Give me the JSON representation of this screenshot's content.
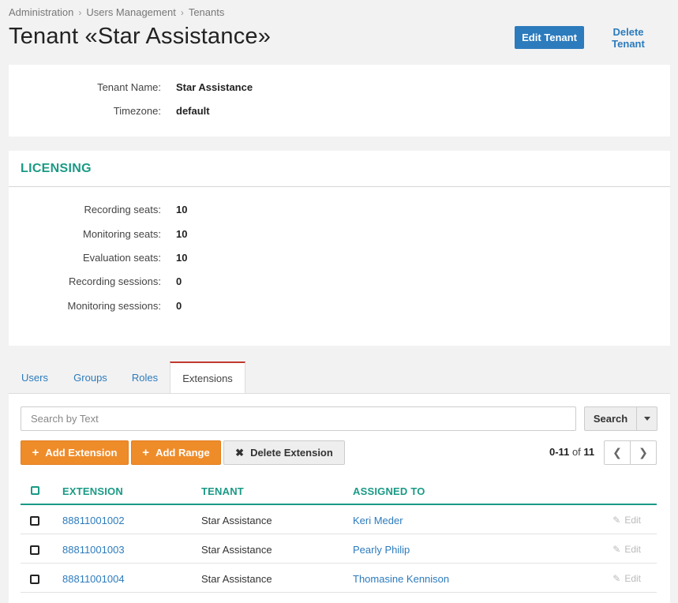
{
  "breadcrumb": [
    "Administration",
    "Users Management",
    "Tenants"
  ],
  "page": {
    "title": "Tenant «Star Assistance»",
    "edit_label": "Edit Tenant",
    "delete_label": "Delete Tenant"
  },
  "info": {
    "tenant_name_label": "Tenant Name:",
    "tenant_name_value": "Star Assistance",
    "timezone_label": "Timezone:",
    "timezone_value": "default"
  },
  "licensing": {
    "title": "LICENSING",
    "rows": [
      {
        "label": "Recording seats:",
        "value": "10"
      },
      {
        "label": "Monitoring seats:",
        "value": "10"
      },
      {
        "label": "Evaluation seats:",
        "value": "10"
      },
      {
        "label": "Recording sessions:",
        "value": "0"
      },
      {
        "label": "Monitoring sessions:",
        "value": "0"
      }
    ]
  },
  "tabs": [
    "Users",
    "Groups",
    "Roles",
    "Extensions"
  ],
  "active_tab": "Extensions",
  "search": {
    "placeholder": "Search by Text",
    "button": "Search"
  },
  "actions": {
    "add_extension": "Add Extension",
    "add_range": "Add Range",
    "delete_extension": "Delete Extension"
  },
  "pager": {
    "range": "0-11",
    "of": "of",
    "total": "11"
  },
  "table": {
    "headers": [
      "EXTENSION",
      "TENANT",
      "ASSIGNED TO"
    ],
    "edit_label": "Edit",
    "rows": [
      {
        "extension": "88811001002",
        "tenant": "Star Assistance",
        "assigned_to": "Keri Meder"
      },
      {
        "extension": "88811001003",
        "tenant": "Star Assistance",
        "assigned_to": "Pearly Philip"
      },
      {
        "extension": "88811001004",
        "tenant": "Star Assistance",
        "assigned_to": "Thomasine Kennison"
      }
    ]
  },
  "colors": {
    "primary": "#2c7bbd",
    "accent_green": "#1a9a86",
    "action_orange": "#ef8c2a",
    "active_tab_marker": "#c0392b"
  }
}
